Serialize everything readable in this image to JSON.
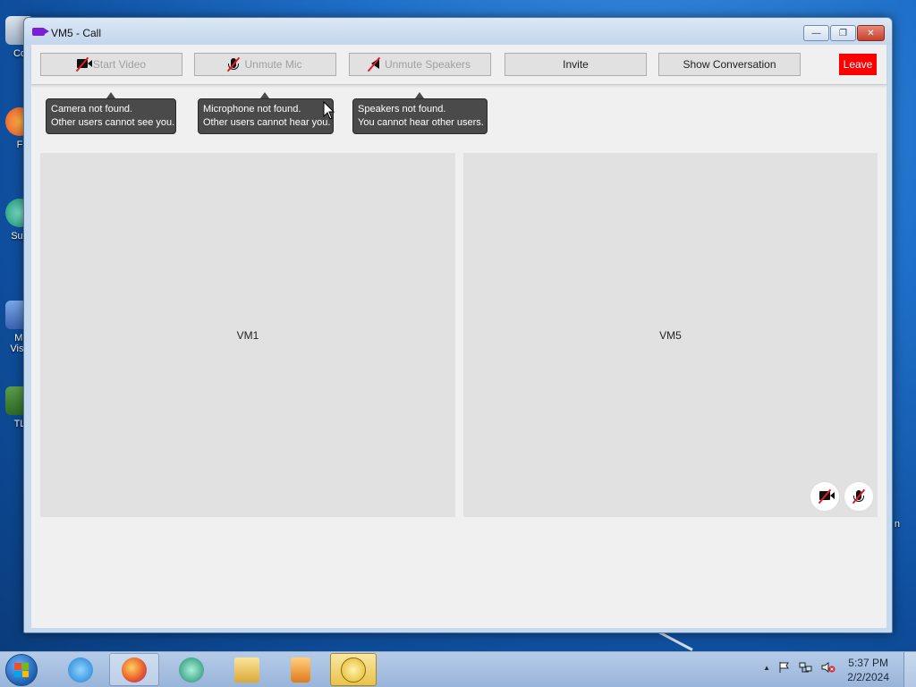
{
  "window": {
    "title": "VM5 - Call",
    "minimize_label": "—",
    "maximize_label": "❐",
    "close_label": "✕"
  },
  "toolbar": {
    "start_video": "Start Video",
    "unmute_mic": "Unmute Mic",
    "unmute_speakers": "Unmute Speakers",
    "invite": "Invite",
    "show_conversation": "Show Conversation",
    "leave": "Leave",
    "leave_color": "#ff0000"
  },
  "tooltips": {
    "camera": {
      "line1": "Camera not found.",
      "line2": "Other users cannot see you."
    },
    "microphone": {
      "line1": "Microphone not found.",
      "line2": "Other users cannot hear you."
    },
    "speakers": {
      "line1": "Speakers not found.",
      "line2": "You cannot hear other users."
    }
  },
  "participants": [
    {
      "name": "VM1"
    },
    {
      "name": "VM5",
      "camera_off_icon": "camera-off-icon",
      "mic_off_icon": "mic-off-icon"
    }
  ],
  "desktop": {
    "icons": [
      "Co",
      "F",
      "Sup",
      "Mi\nVisu",
      "TL"
    ],
    "right_label": "n"
  },
  "taskbar": {
    "apps": [
      "internet-explorer-icon",
      "firefox-icon",
      "teams-icon",
      "file-explorer-icon",
      "media-player-icon",
      "chat-app-icon"
    ],
    "time": "5:37 PM",
    "date": "2/2/2024",
    "tray_chevron": "▲"
  }
}
